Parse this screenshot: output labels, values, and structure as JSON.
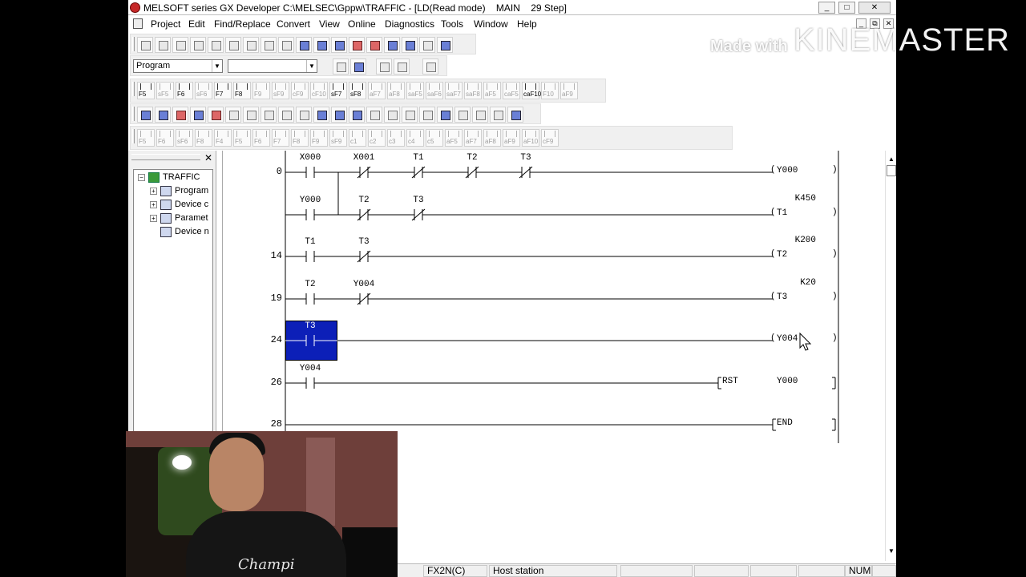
{
  "window": {
    "title": "MELSOFT series GX Developer C:\\MELSEC\\Gppw\\TRAFFIC - [LD(Read mode)    MAIN    29 Step]",
    "controls": {
      "minimize": "_",
      "maximize": "□",
      "close": "✕"
    },
    "mdi_controls": {
      "minimize": "_",
      "restore": "⧉",
      "close": "✕"
    }
  },
  "menu": [
    "Project",
    "Edit",
    "Find/Replace",
    "Convert",
    "View",
    "Online",
    "Diagnostics",
    "Tools",
    "Window",
    "Help"
  ],
  "toolbar": {
    "program_select": "Program",
    "second_select": "",
    "function_keys": [
      {
        "label": "F5",
        "dim": false
      },
      {
        "label": "sF5",
        "dim": true
      },
      {
        "label": "F6",
        "dim": false
      },
      {
        "label": "sF6",
        "dim": true
      },
      {
        "label": "F7",
        "dim": false
      },
      {
        "label": "F8",
        "dim": false
      },
      {
        "label": "F9",
        "dim": true
      },
      {
        "label": "sF9",
        "dim": true
      },
      {
        "label": "cF9",
        "dim": true
      },
      {
        "label": "cF10",
        "dim": true
      },
      {
        "label": "sF7",
        "dim": false
      },
      {
        "label": "sF8",
        "dim": false
      },
      {
        "label": "aF7",
        "dim": true
      },
      {
        "label": "aF8",
        "dim": true
      },
      {
        "label": "saF5",
        "dim": true
      },
      {
        "label": "saF6",
        "dim": true
      },
      {
        "label": "saF7",
        "dim": true
      },
      {
        "label": "saF8",
        "dim": true
      },
      {
        "label": "aF5",
        "dim": true
      },
      {
        "label": "caF5",
        "dim": true
      },
      {
        "label": "caF10",
        "dim": false
      },
      {
        "label": "F10",
        "dim": true
      },
      {
        "label": "aF9",
        "dim": true
      }
    ],
    "function_keys_2": [
      "F5",
      "F6",
      "sF6",
      "F8",
      "F4",
      "F5",
      "F6",
      "F7",
      "F8",
      "F9",
      "sF9",
      "c1",
      "c2",
      "c3",
      "c4",
      "c5",
      "aF5",
      "aF7",
      "aF8",
      "aF9",
      "aF10",
      "cF9"
    ]
  },
  "project_tree": {
    "close": "✕",
    "nodes": [
      {
        "label": "TRAFFIC",
        "expander": "−",
        "icon": "project-icon"
      },
      {
        "label": "Program",
        "expander": "+",
        "icon": "program-icon"
      },
      {
        "label": "Device c",
        "expander": "+",
        "icon": "device-comment-icon"
      },
      {
        "label": "Paramet",
        "expander": "+",
        "icon": "parameter-icon"
      },
      {
        "label": "Device n",
        "expander": "",
        "icon": "device-memory-icon"
      }
    ]
  },
  "ladder": {
    "rungs": [
      {
        "step": "0",
        "contacts": [
          {
            "device": "X000",
            "type": "no"
          },
          {
            "device": "X001",
            "type": "nc"
          },
          {
            "device": "T1",
            "type": "nc"
          },
          {
            "device": "T2",
            "type": "nc"
          },
          {
            "device": "T3",
            "type": "nc"
          }
        ],
        "output": "Y000",
        "k": "",
        "instr": "",
        "operand": ""
      },
      {
        "step": "",
        "contacts": [
          {
            "device": "Y000",
            "type": "no"
          },
          {
            "device": "T2",
            "type": "nc"
          },
          {
            "device": "T3",
            "type": "nc"
          }
        ],
        "output": "T1",
        "k": "K450",
        "instr": "",
        "operand": ""
      },
      {
        "step": "14",
        "contacts": [
          {
            "device": "T1",
            "type": "no"
          },
          {
            "device": "T3",
            "type": "nc"
          }
        ],
        "output": "T2",
        "k": "K200",
        "instr": "",
        "operand": ""
      },
      {
        "step": "19",
        "contacts": [
          {
            "device": "T2",
            "type": "no"
          },
          {
            "device": "Y004",
            "type": "nc"
          }
        ],
        "output": "T3",
        "k": "K20",
        "instr": "",
        "operand": ""
      },
      {
        "step": "24",
        "contacts": [
          {
            "device": "T3",
            "type": "no"
          }
        ],
        "output": "Y004",
        "k": "",
        "instr": "",
        "operand": ""
      },
      {
        "step": "26",
        "contacts": [
          {
            "device": "Y004",
            "type": "no"
          }
        ],
        "output": "",
        "k": "",
        "instr": "RST",
        "operand": "Y000"
      },
      {
        "step": "28",
        "contacts": [],
        "output": "",
        "k": "",
        "instr": "END",
        "operand": ""
      }
    ]
  },
  "statusbar": {
    "cpu": "FX2N(C)",
    "station": "Host station",
    "num": "NUM"
  },
  "watermark": {
    "made": "Made with",
    "brand": "KINEMASTER"
  },
  "webcam": {
    "shirt_text": "Champi"
  },
  "colors": {
    "cursor": "#0c1fb8",
    "ladder_line": "#000000",
    "menu_bg": "#ffffff",
    "toolbar_bg": "#f0f0f0"
  }
}
